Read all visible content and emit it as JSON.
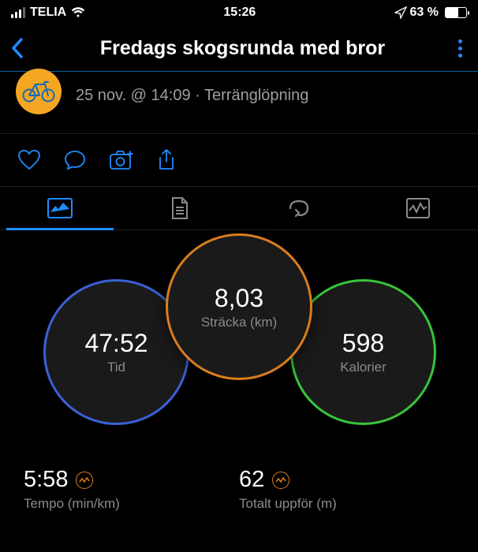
{
  "status": {
    "carrier": "TELIA",
    "time": "15:26",
    "battery_pct": "63 %"
  },
  "header": {
    "title": "Fredags skogsrunda med bror"
  },
  "activity": {
    "timestamp": "25 nov. @ 14:09",
    "type": "Terränglöpning"
  },
  "circles": {
    "center": {
      "value": "8,03",
      "label": "Sträcka (km)"
    },
    "left": {
      "value": "47:52",
      "label": "Tid"
    },
    "right": {
      "value": "598",
      "label": "Kalorier"
    }
  },
  "stats": [
    {
      "value": "5:58",
      "label": "Tempo (min/km)"
    },
    {
      "value": "62",
      "label": "Totalt uppför (m)"
    }
  ],
  "colors": {
    "accent": "#1f8cff",
    "distance_ring": "#d97c1e",
    "time_ring": "#3a62d6",
    "calories_ring": "#38c43c"
  }
}
